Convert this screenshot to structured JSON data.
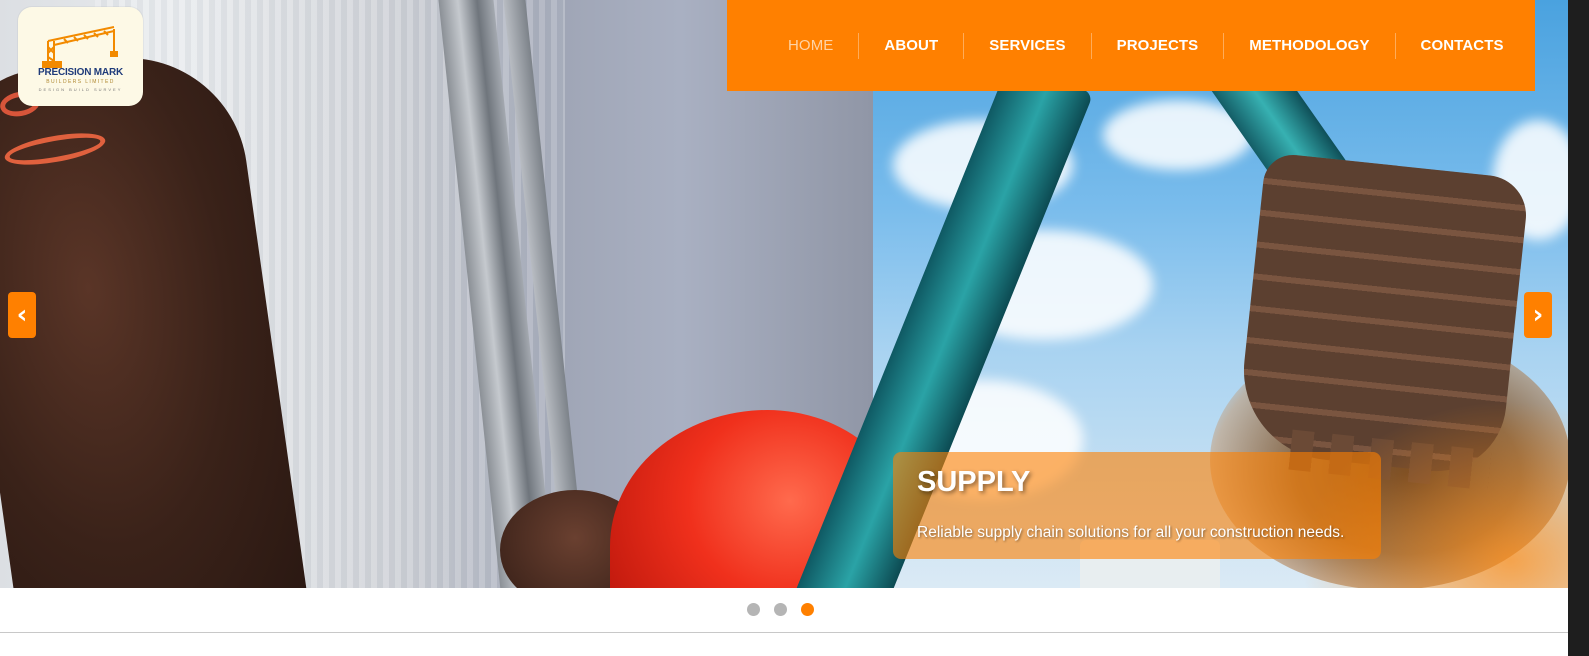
{
  "brand": {
    "name": "PRECISION MARK",
    "subtitle": "BUILDERS LIMITED",
    "tagline": "DESIGN BUILD SURVEY"
  },
  "nav": {
    "items": [
      {
        "label": "HOME",
        "active": true
      },
      {
        "label": "ABOUT",
        "active": false
      },
      {
        "label": "SERVICES",
        "active": false
      },
      {
        "label": "PROJECTS",
        "active": false
      },
      {
        "label": "METHODOLOGY",
        "active": false
      },
      {
        "label": "CONTACTS",
        "active": false
      }
    ]
  },
  "slider": {
    "prev_icon": "‹",
    "next_icon": "›",
    "caption": {
      "title": "SUPPLY",
      "description": "Reliable supply chain solutions for all your construction needs."
    },
    "slide_count": 3,
    "active_slide": 3
  },
  "colors": {
    "accent": "#ff8000",
    "nav_active_text": "#ffd3a6",
    "dot_inactive": "#b5b5b5"
  }
}
